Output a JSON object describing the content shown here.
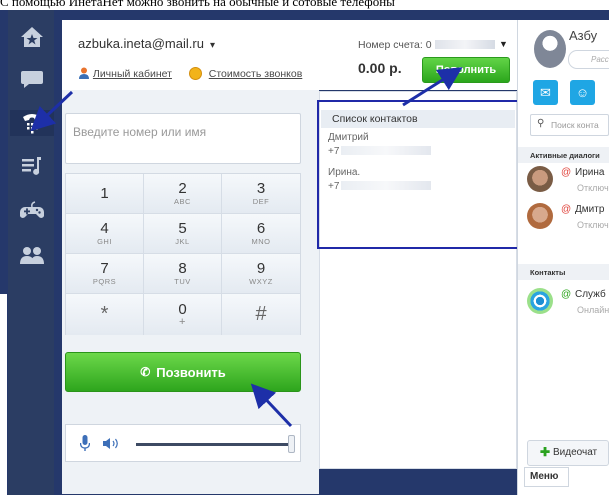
{
  "caption": "С помощью ИнетаНет можно звонить на обычные и сотовые телефоны",
  "account": {
    "email": "azbuka.ineta@mail.ru",
    "email_caret": "▾",
    "cabinet_link": "Личный кабинет",
    "cost_link": "Стоимость звонков",
    "account_number_label": "Номер счета: 0",
    "balance": "0.00 р.",
    "topup_button": "Пополнить"
  },
  "dialer": {
    "input_placeholder": "Введите номер или имя",
    "keys": [
      {
        "digit": "1",
        "letters": ""
      },
      {
        "digit": "2",
        "letters": "ABC"
      },
      {
        "digit": "3",
        "letters": "DEF"
      },
      {
        "digit": "4",
        "letters": "GHI"
      },
      {
        "digit": "5",
        "letters": "JKL"
      },
      {
        "digit": "6",
        "letters": "MNO"
      },
      {
        "digit": "7",
        "letters": "PQRS"
      },
      {
        "digit": "8",
        "letters": "TUV"
      },
      {
        "digit": "9",
        "letters": "WXYZ"
      },
      {
        "digit": "*",
        "letters": ""
      },
      {
        "digit": "0",
        "letters": "+"
      },
      {
        "digit": "#",
        "letters": ""
      }
    ],
    "call_button": "Позвонить",
    "volume_level": 0.95
  },
  "contacts": {
    "header": "Список контактов",
    "items": [
      {
        "name": "Дмитрий",
        "phone": "+7"
      },
      {
        "name": "Ирина.",
        "phone": "+7"
      }
    ]
  },
  "sidebar": {
    "user_name": "Азбу",
    "status_placeholder": "Расс",
    "search_placeholder": "Поиск конта",
    "active_dialogs_header": "Активные диалоги",
    "dialogs": [
      {
        "name": "Ирина",
        "status": "Отключ"
      },
      {
        "name": "Дмитр",
        "status": "Отключ"
      }
    ],
    "contacts_header": "Контакты",
    "contacts": [
      {
        "name": "Служб",
        "status": "Онлайн"
      }
    ],
    "video_chat_button": "Видеочат",
    "menu_tab": "Меню",
    "at_sign": "@"
  },
  "colors": {
    "rail_bg": "#2b3d63",
    "accent_green": "#2ea51d",
    "highlight_border": "#2029a8",
    "link_blue": "#1fa6e4"
  }
}
